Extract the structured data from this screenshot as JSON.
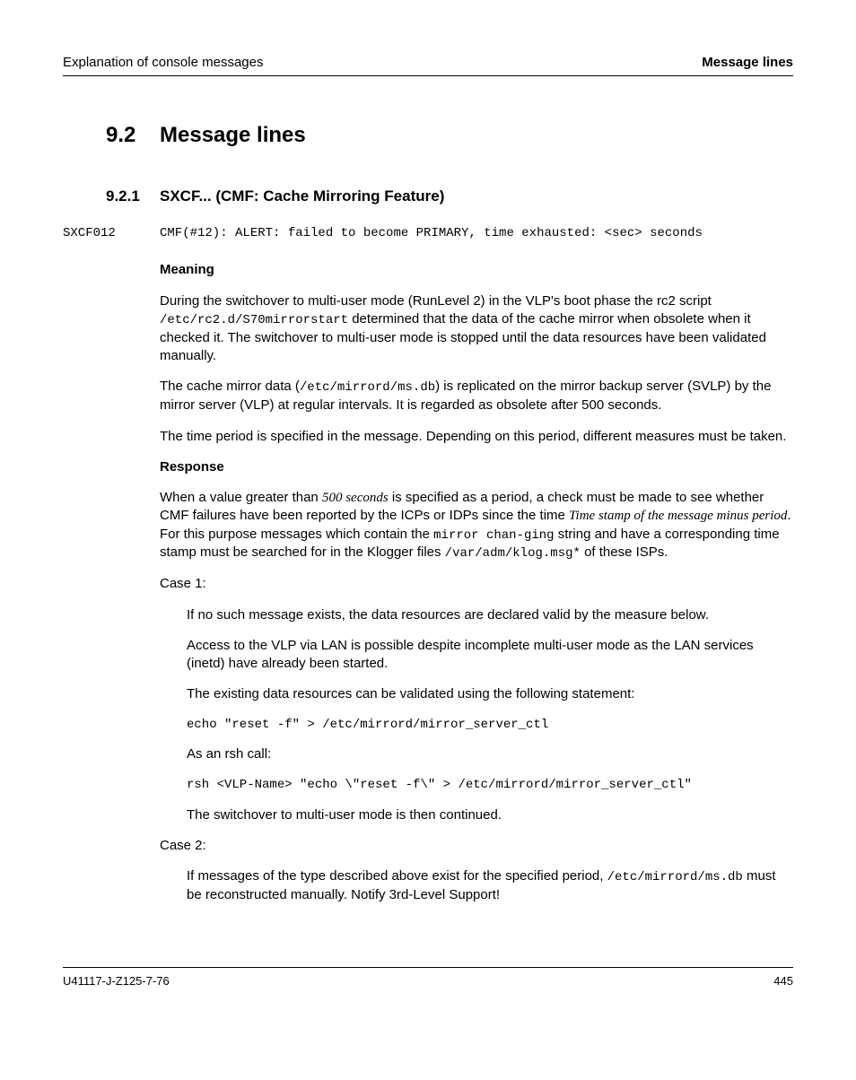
{
  "header": {
    "left": "Explanation of console messages",
    "right": "Message lines"
  },
  "section": {
    "number": "9.2",
    "title": "Message lines"
  },
  "subsection": {
    "number": "9.2.1",
    "title": "SXCF... (CMF: Cache Mirroring Feature)"
  },
  "message": {
    "code": "SXCF012",
    "text": "CMF(#12): ALERT: failed to become PRIMARY, time exhausted:  <sec>  seconds"
  },
  "labels": {
    "meaning": "Meaning",
    "response": "Response"
  },
  "meaning": {
    "p1a": "During the switchover to multi-user mode (RunLevel 2) in the VLP's boot phase the rc2 script ",
    "p1code": "/etc/rc2.d/S70mirrorstart",
    "p1b": " determined that the data of the cache mirror when obsolete when it checked it. The switchover to multi-user mode is stopped until the data resources have been validated manually.",
    "p2a": "The cache mirror data (",
    "p2code": "/etc/mirrord/ms.db",
    "p2b": ") is replicated on the mirror backup server (SVLP) by the mirror server (VLP) at regular intervals. It is regarded as obsolete after 500 seconds.",
    "p3": "The time period is specified in the message. Depending on this period, different measures must be taken."
  },
  "response": {
    "p1a": "When a value greater than ",
    "p1ital": "500 seconds",
    "p1b": " is specified as a period, a check must be made to see whether CMF failures have been reported by the ICPs or IDPs since the time ",
    "p1ital2": "Time stamp of the message minus period",
    "p1c": ". For this purpose messages which contain the ",
    "p1code1": "mirror chan-ging",
    "p1d": " string and have a corresponding time stamp must be searched for in the Klogger files ",
    "p1code2": "/var/adm/klog.msg*",
    "p1e": " of these ISPs.",
    "case1_label": "Case 1:",
    "case1_p1": "If no such message exists, the data resources are declared valid by the measure below.",
    "case1_p2": "Access to the VLP via LAN is possible despite incomplete multi-user mode as the LAN services (inetd) have already been started.",
    "case1_p3": "The existing data resources can be validated using the following statement:",
    "case1_code1": "echo \"reset -f\" > /etc/mirrord/mirror_server_ctl",
    "case1_p4": "As an rsh call:",
    "case1_code2": "rsh <VLP-Name> \"echo \\\"reset -f\\\" > /etc/mirrord/mirror_server_ctl\"",
    "case1_p5": "The switchover to multi-user mode is then continued.",
    "case2_label": "Case 2:",
    "case2_p1a": "If messages of the type described above exist for the specified period, ",
    "case2_code": "/etc/mirrord/ms.db",
    "case2_p1b": " must be reconstructed manually. Notify 3rd-Level Support!"
  },
  "footer": {
    "left": "U41117-J-Z125-7-76",
    "right": "445"
  }
}
